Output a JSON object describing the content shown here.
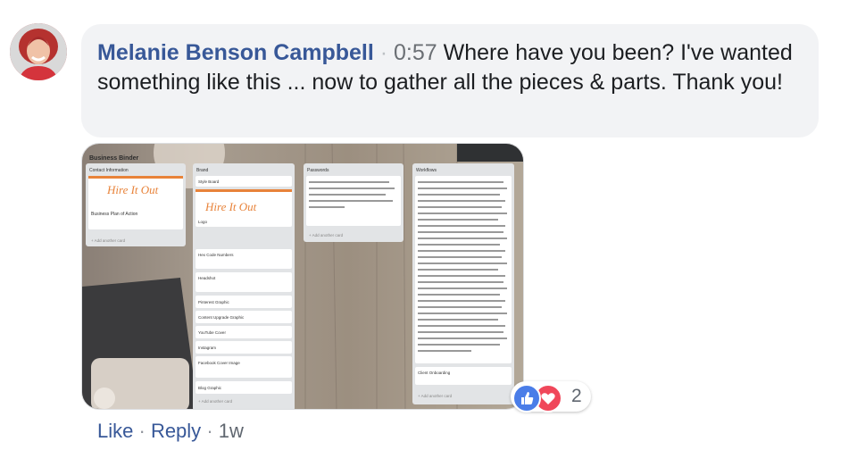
{
  "comment": {
    "author": "Melanie Benson Campbell",
    "separator": "·",
    "timestamp": "0:57",
    "text": "Where have you been? I've wanted something like this ... now to gather all the pieces & parts. Thank you!"
  },
  "attachment": {
    "title": "Business Binder",
    "lists": [
      {
        "title": "Contact Information",
        "cards": [
          "Hire It Out",
          "Business Plan of Action"
        ],
        "add": "+ Add another card"
      },
      {
        "title": "Brand",
        "cards": [
          "Style Board",
          "Hire It Out",
          "Logo",
          "Hex Code Numbers",
          "Headshot",
          "Pinterest Graphic",
          "Content Upgrade Graphic",
          "YouTube Cover",
          "Instagram",
          "Facebook Cover Image",
          "Blog Graphic"
        ],
        "add": "+ Add another card"
      },
      {
        "title": "Passwords",
        "cards": [
          "I use LastPass for all my passwords. I recommend adding the link here for easy reference. (In case you are out and about and need to access an account.)"
        ],
        "add": "+ Add another card"
      },
      {
        "title": "Workflows",
        "cards": [
          "Get ready to become a productivity ninja. Workflows are systems and checklists that need to be used in order to complete a task. What do you do in your business over and over again? It is IMPORTANT that even know you think you are a ninja, remember the 7000 Hour Test. Have you completed the task for 7000 Hours? Even my husband, a senior airman uses the same systems and checklists every time he gets in and leaves the helicopter. This is a hub for your workflows to live. Don't check off items in your workflow. This is your template that you can copy and edit where you need it. Another benefit when you are ready to bring on someone to help you. I guess what? You already have a system, training, and checklist in place. Oh no, what are you going to do with all that time you just got back!",
          "Client Onboarding"
        ],
        "add": "+ Add another card"
      }
    ]
  },
  "reactions": {
    "count": "2",
    "icons": [
      "like-icon",
      "love-icon"
    ],
    "colors": {
      "like": "#4a7de8",
      "love": "#f0475a"
    }
  },
  "actions": {
    "like": "Like",
    "reply": "Reply",
    "dot": "·",
    "time": "1w"
  },
  "colors": {
    "author": "#385898",
    "bubble": "#f2f3f5",
    "link": "#385898"
  }
}
